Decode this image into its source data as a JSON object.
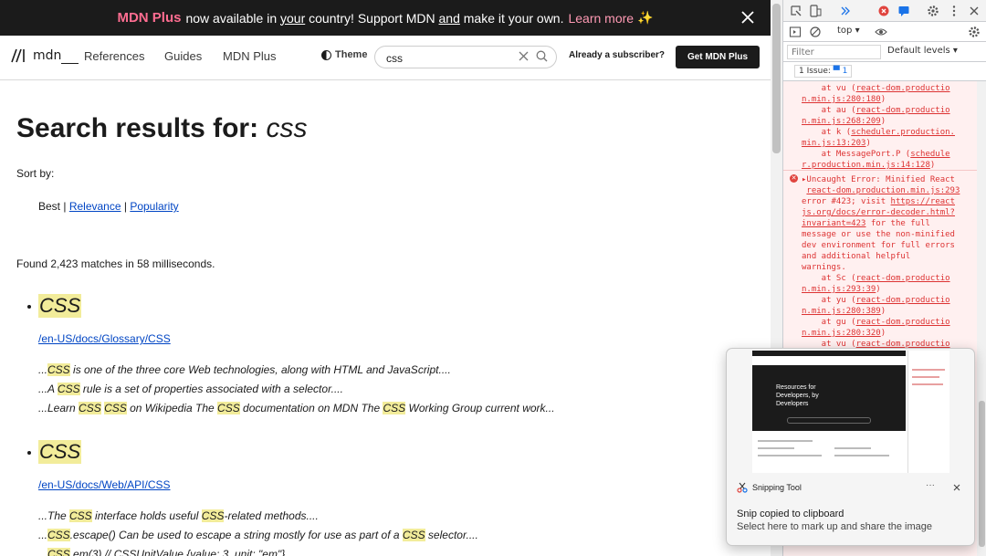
{
  "banner": {
    "plus": "MDN Plus",
    "part1": "now available in",
    "your": "your",
    "part2": "country! Support MDN",
    "and": "and",
    "part3": "make it your own.",
    "learn_more": "Learn more",
    "sparkle": "✨"
  },
  "nav": {
    "logo_text": "mdn",
    "references": "References",
    "guides": "Guides",
    "mdn_plus": "MDN Plus",
    "theme": "Theme",
    "search_value": "css",
    "subscriber": "Already a subscriber?",
    "get_plus": "Get MDN Plus"
  },
  "main": {
    "title_prefix": "Search results for:",
    "query": "css",
    "sort_label": "Sort by:",
    "sort_best": "Best",
    "sort_relevance": "Relevance",
    "sort_popularity": "Popularity",
    "found": "Found 2,423 matches in 58 milliseconds."
  },
  "results": [
    {
      "title": "CSS",
      "url": "/en-US/docs/Glossary/CSS",
      "snippets": [
        [
          {
            "t": "..."
          },
          {
            "m": "CSS"
          },
          {
            "t": " is one of the three core Web technologies, along with HTML and JavaScript...."
          }
        ],
        [
          {
            "t": "...A "
          },
          {
            "m": "CSS"
          },
          {
            "t": " rule is a set of properties associated with a selector...."
          }
        ],
        [
          {
            "t": "...Learn "
          },
          {
            "m": "CSS"
          },
          {
            "t": " "
          },
          {
            "m": "CSS"
          },
          {
            "t": " on Wikipedia The "
          },
          {
            "m": "CSS"
          },
          {
            "t": " documentation on MDN The "
          },
          {
            "m": "CSS"
          },
          {
            "t": " Working Group current work..."
          }
        ]
      ]
    },
    {
      "title": "CSS",
      "url": "/en-US/docs/Web/API/CSS",
      "snippets": [
        [
          {
            "t": "...The "
          },
          {
            "m": "CSS"
          },
          {
            "t": " interface holds useful "
          },
          {
            "m": "CSS"
          },
          {
            "t": "-related methods...."
          }
        ],
        [
          {
            "t": "..."
          },
          {
            "m": "CSS"
          },
          {
            "t": ".escape() Can be used to escape a string mostly for use as part of a "
          },
          {
            "m": "CSS"
          },
          {
            "t": " selector...."
          }
        ],
        [
          {
            "t": "..."
          },
          {
            "m": "CSS"
          },
          {
            "t": ".em(3) // CSSUnitValue {value: 3, unit: \"em\"}"
          }
        ]
      ]
    }
  ],
  "devtools": {
    "context": "top",
    "filter_placeholder": "Filter",
    "levels": "Default levels",
    "issues_label": "1 Issue:",
    "issues_count": "1",
    "lines": [
      {
        "pre": "    at vu (",
        "link": "react-dom.productio",
        "post": ""
      },
      {
        "pre": "",
        "link": "n.min.js:280:180",
        "post": ")"
      },
      {
        "pre": "    at au (",
        "link": "react-dom.productio",
        "post": ""
      },
      {
        "pre": "",
        "link": "n.min.js:268:209",
        "post": ")"
      },
      {
        "pre": "    at k (",
        "link": "scheduler.production.",
        "post": ""
      },
      {
        "pre": "",
        "link": "min.js:13:203",
        "post": ")"
      },
      {
        "pre": "    at MessagePort.P (",
        "link": "schedule",
        "post": ""
      },
      {
        "pre": "",
        "link": "r.production.min.js:14:128",
        "post": ")"
      }
    ],
    "error_lines": [
      {
        "pre": "▸Uncaught Error: Minified React",
        "link": "",
        "post": ""
      },
      {
        "pre": " ",
        "link": "react-dom.production.min.js:293",
        "post": ""
      },
      {
        "pre": "error #423; visit ",
        "link": "https://react",
        "post": ""
      },
      {
        "pre": "",
        "link": "js.org/docs/error-decoder.html?",
        "post": ""
      },
      {
        "pre": "",
        "link": "invariant=423",
        "post": " for the full"
      },
      {
        "pre": "message or use the non-minified",
        "link": "",
        "post": ""
      },
      {
        "pre": "dev environment for full errors",
        "link": "",
        "post": ""
      },
      {
        "pre": "and additional helpful",
        "link": "",
        "post": ""
      },
      {
        "pre": "warnings.",
        "link": "",
        "post": ""
      },
      {
        "pre": "    at Sc (",
        "link": "react-dom.productio",
        "post": ""
      },
      {
        "pre": "",
        "link": "n.min.js:293:39",
        "post": ")"
      },
      {
        "pre": "    at yu (",
        "link": "react-dom.productio",
        "post": ""
      },
      {
        "pre": "",
        "link": "n.min.js:280:389",
        "post": ")"
      },
      {
        "pre": "    at gu (",
        "link": "react-dom.productio",
        "post": ""
      },
      {
        "pre": "",
        "link": "n.min.js:280:320",
        "post": ")"
      },
      {
        "pre": "    at vu (",
        "link": "react-dom.productio",
        "post": ""
      }
    ]
  },
  "toast": {
    "app": "Snipping Tool",
    "more": "···",
    "title": "Snip copied to clipboard",
    "subtitle": "Select here to mark up and share the image",
    "thumb_text": "Resources for Developers, by Developers"
  },
  "colors": {
    "highlight": "#f2ec9a",
    "link": "#0045c4",
    "banner_bg": "#1b1b1b",
    "plus_pink": "#ff6d91",
    "error_red": "#dd3333",
    "error_bg": "#fff0f0"
  }
}
